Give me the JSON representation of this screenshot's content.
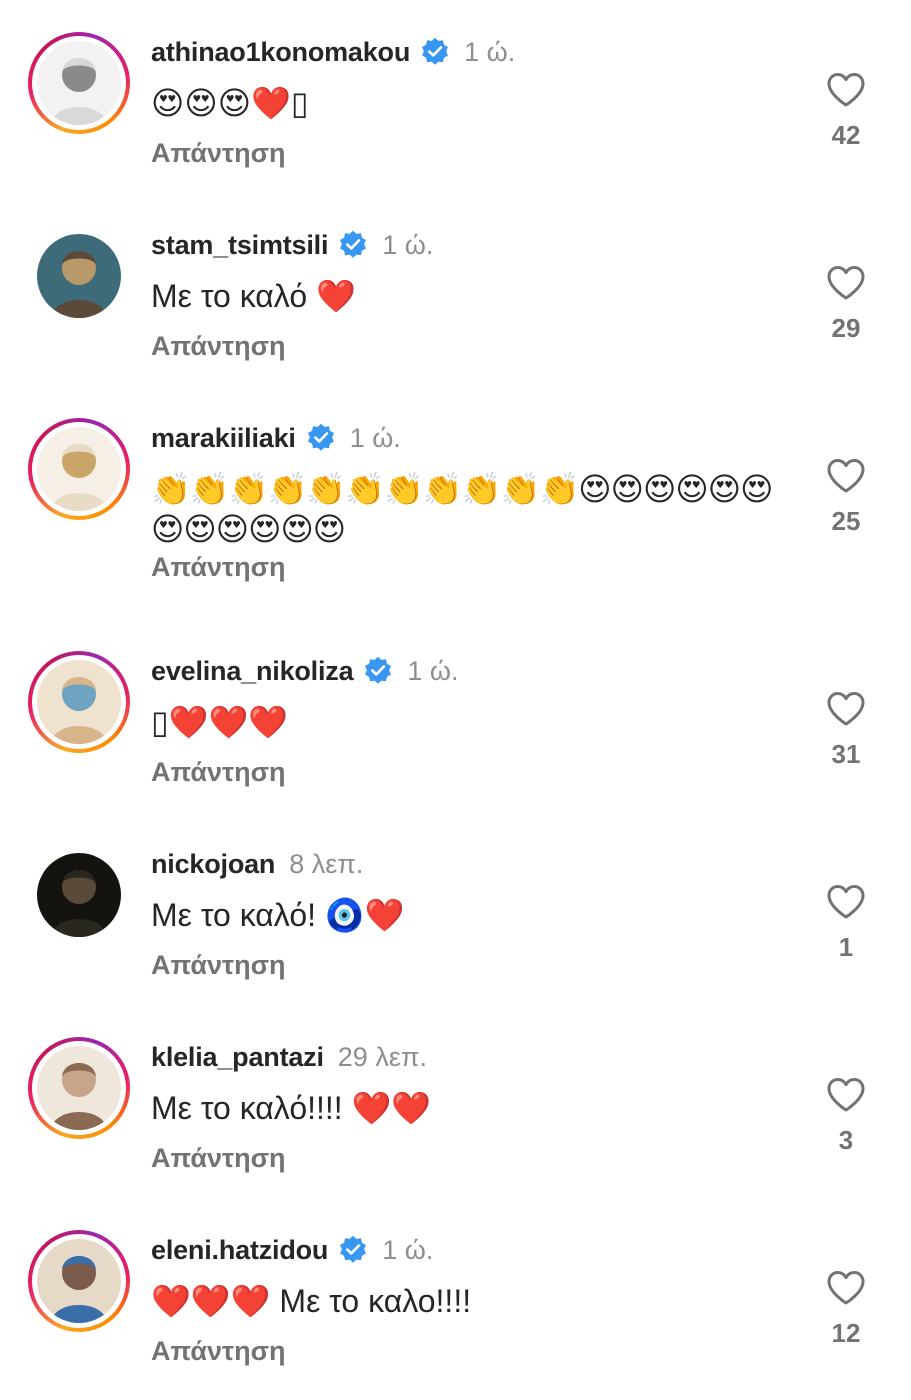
{
  "reply_label": "Απάντηση",
  "colors": {
    "verified": "#3897f0",
    "text": "#262626",
    "muted": "#737373"
  },
  "comments": [
    {
      "username": "athinao1konomakou",
      "verified": true,
      "time": "1 ώ.",
      "text": "😍😍😍❤️▯",
      "likes": "42",
      "story_ring": true,
      "avatar_icon": "avatar-woman-blonde"
    },
    {
      "username": "stam_tsimtsili",
      "verified": true,
      "time": "1 ώ.",
      "text": "Με το καλό ❤️",
      "likes": "29",
      "story_ring": false,
      "avatar_icon": "avatar-woman-headscarf"
    },
    {
      "username": "marakiiliaki",
      "verified": true,
      "time": "1 ώ.",
      "text": "👏👏👏👏👏👏👏👏👏👏👏😍😍😍😍😍😍😍😍😍😍😍😍",
      "likes": "25",
      "story_ring": true,
      "avatar_icon": "avatar-woman-blonde-smiling"
    },
    {
      "username": "evelina_nikoliza",
      "verified": true,
      "time": "1 ώ.",
      "text": "▯❤️❤️❤️",
      "likes": "31",
      "story_ring": true,
      "avatar_icon": "avatar-woman-hat-beach"
    },
    {
      "username": "nickojoan",
      "verified": false,
      "time": "8 λεπ.",
      "text": "Με το καλό! 🧿❤️",
      "likes": "1",
      "story_ring": false,
      "avatar_icon": "avatar-man-dark"
    },
    {
      "username": "klelia_pantazi",
      "verified": false,
      "time": "29 λεπ.",
      "text": "Με το καλό!!!! ❤️❤️",
      "likes": "3",
      "story_ring": true,
      "avatar_icon": "avatar-woman-brunette-smiling"
    },
    {
      "username": "eleni.hatzidou",
      "verified": true,
      "time": "1 ώ.",
      "text": "❤️❤️❤️ Με το καλο!!!!",
      "likes": "12",
      "story_ring": true,
      "avatar_icon": "avatar-woman-studio"
    }
  ]
}
